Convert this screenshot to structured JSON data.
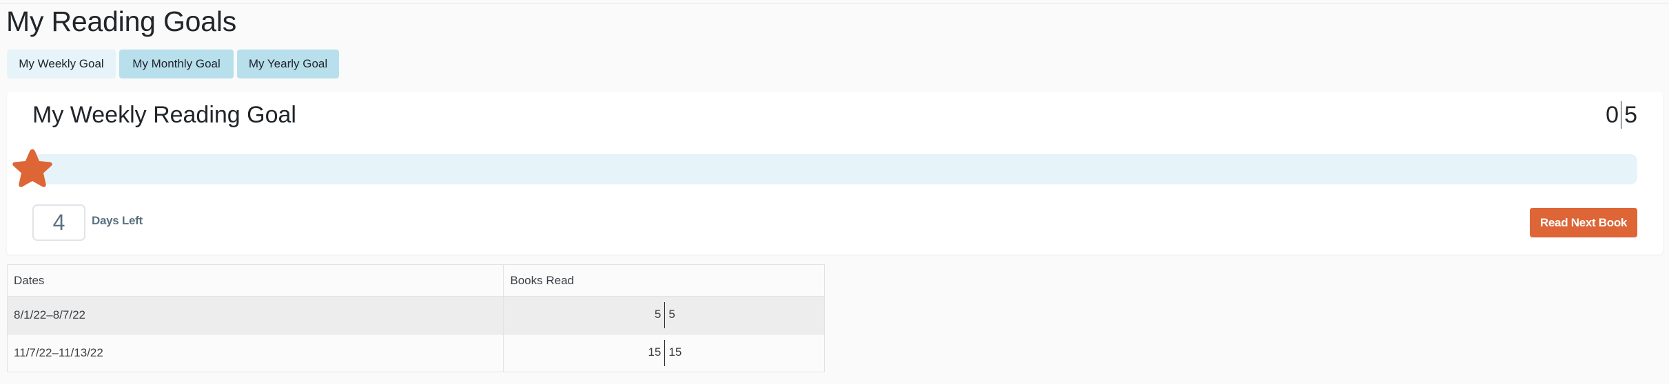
{
  "page": {
    "title": "My Reading Goals"
  },
  "tabs": [
    {
      "label": "My Weekly Goal",
      "active": true
    },
    {
      "label": "My Monthly Goal",
      "active": false
    },
    {
      "label": "My Yearly Goal",
      "active": false
    }
  ],
  "goal_card": {
    "title": "My Weekly Reading Goal",
    "books_read": "0",
    "books_goal": "5",
    "progress_fraction": 0,
    "progress_icon": "star-icon",
    "days_left_value": "4",
    "days_left_label": "Days Left",
    "read_next_button_label": "Read Next Book"
  },
  "colors": {
    "accent": "#dd6536",
    "progress_track": "#e6f4f9",
    "tab_active": "#e6f4f9",
    "tab_inactive": "#b7dfec",
    "muted_text": "#5a7181"
  },
  "history_table": {
    "columns": [
      "Dates",
      "Books Read"
    ],
    "rows": [
      {
        "dates": "8/1/22–8/7/22",
        "books_read": "5",
        "books_goal": "5"
      },
      {
        "dates": "11/7/22–11/13/22",
        "books_read": "15",
        "books_goal": "15"
      }
    ]
  }
}
